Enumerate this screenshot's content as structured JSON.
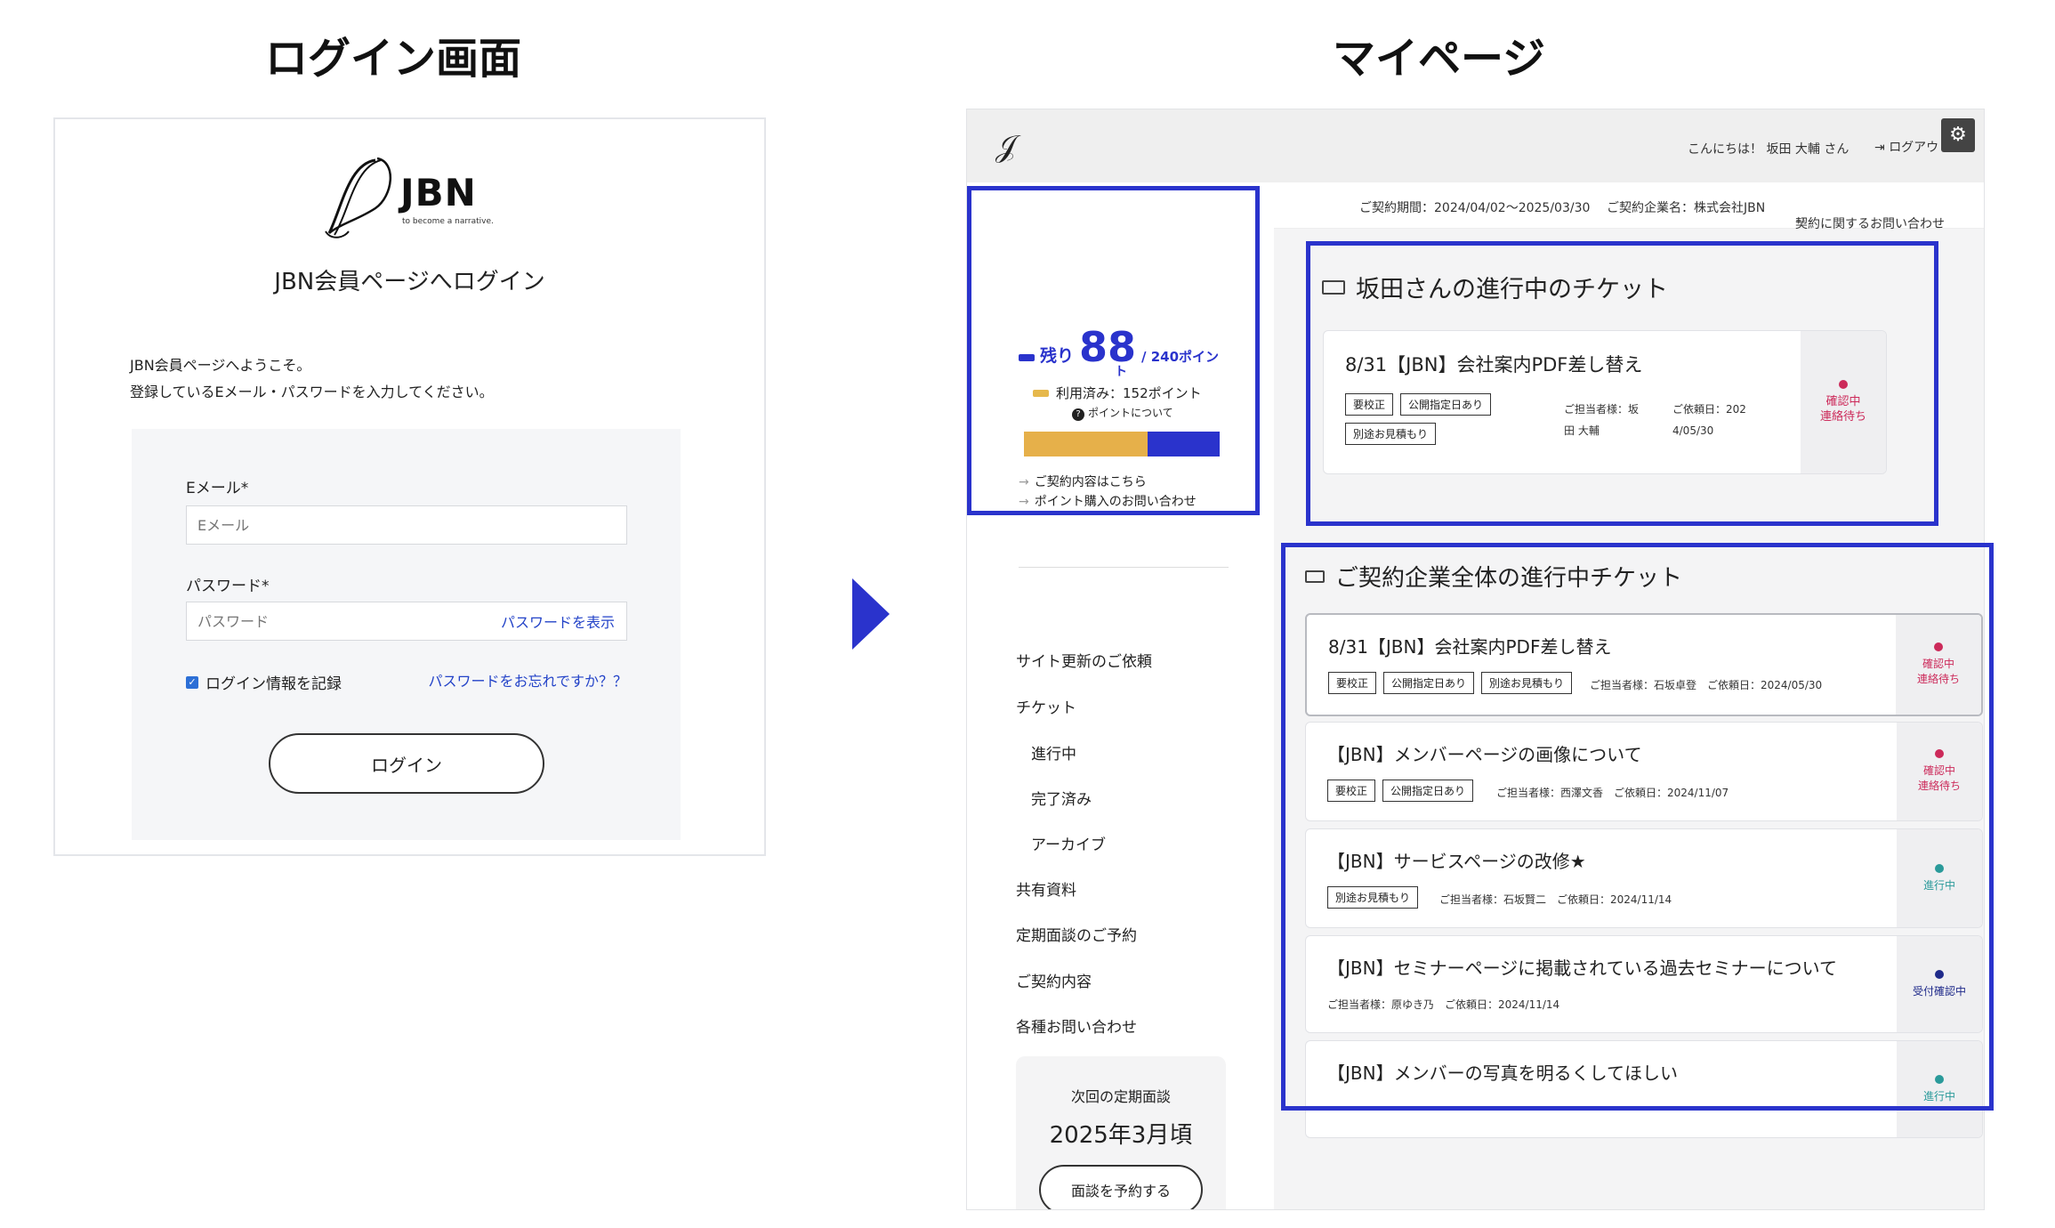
{
  "headings": {
    "login_screen": "ログイン画面",
    "my_page": "マイページ"
  },
  "login": {
    "logo_text": "JBN",
    "logo_tagline": "to become a narrative.",
    "title": "JBN会員ページへログイン",
    "intro_line1": "JBN会員ページへようこそ。",
    "intro_line2": "登録しているEメール・パスワードを入力してください。",
    "email_label": "Eメール*",
    "email_placeholder": "Eメール",
    "password_label": "パスワード*",
    "password_placeholder": "パスワード",
    "show_password": "パスワードを表示",
    "remember_label": "ログイン情報を記録",
    "remember_checked": true,
    "forgot_password": "パスワードをお忘れですか？？",
    "login_button": "ログイン"
  },
  "mypage": {
    "header": {
      "greeting": "こんにちは！ 坂田 大輔 さん",
      "logout": "ログアウト"
    },
    "contract_bar": {
      "period": "ご契約期間：2024/04/02〜2025/03/30",
      "company": "ご契約企業名：株式会社JBN",
      "inquiry": "契約に関するお問い合わせ"
    },
    "points": {
      "remaining_label": "残り",
      "remaining": "88",
      "total": "/ 240ポイン",
      "total_wrap": "ト",
      "used": "利用済み：152ポイント",
      "about": "ポイントについて",
      "used_fraction": 0.633,
      "link_contract": "ご契約内容はこちら",
      "link_purchase": "ポイント購入のお問い合わせ",
      "used_color": "#e6b04a",
      "remaining_color": "#2a33cc"
    },
    "nav": [
      "サイト更新のご依頼",
      "チケット",
      "進行中",
      "完了済み",
      "アーカイブ",
      "共有資料",
      "定期面談のご予約",
      "ご契約内容",
      "各種お問い合わせ"
    ],
    "meeting": {
      "label": "次回の定期面談",
      "date": "2025年3月頃",
      "button": "面談を予約する"
    },
    "my_tickets": {
      "title": "坂田さんの進行中のチケット",
      "items": [
        {
          "title": "8/31【JBN】会社案内PDF差し替え",
          "tags": [
            "要校正",
            "公開指定日あり",
            "別途お見積もり"
          ],
          "assignee_line1": "ご担当者様：坂",
          "assignee_line2": "田 大輔",
          "date_line1": "ご依頼日：202",
          "date_line2": "4/05/30",
          "status": "確認中\n連絡待ち"
        }
      ]
    },
    "company_tickets": {
      "title": "ご契約企業全体の進行中チケット",
      "items": [
        {
          "title": "8/31【JBN】会社案内PDF差し替え",
          "tags": [
            "要校正",
            "公開指定日あり",
            "別途お見積もり"
          ],
          "meta": "ご担当者様：石坂卓登　ご依頼日：2024/05/30",
          "status": "確認中\n連絡待ち"
        },
        {
          "title": "【JBN】メンバーページの画像について",
          "tags": [
            "要校正",
            "公開指定日あり"
          ],
          "meta": "ご担当者様：西澤文香　ご依頼日：2024/11/07",
          "status": "確認中\n連絡待ち"
        },
        {
          "title": "【JBN】サービスページの改修★",
          "tags": [
            "別途お見積もり"
          ],
          "meta": "ご担当者様：石坂賢二　ご依頼日：2024/11/14",
          "status": "進行中"
        },
        {
          "title": "【JBN】セミナーページに掲載されている過去セミナーについて",
          "tags": [],
          "meta": "ご担当者様：原ゆき乃　ご依頼日：2024/11/14",
          "status": "受付確認中"
        },
        {
          "title": "【JBN】メンバーの写真を明るくしてほしい",
          "tags": [],
          "meta": "",
          "status": "進行中"
        }
      ]
    }
  },
  "colors": {
    "accent_blue": "#2a33cc",
    "status_confirm": "#cc2a5a",
    "status_progress": "#2a9a9a",
    "status_accept": "#1f2a8a"
  }
}
